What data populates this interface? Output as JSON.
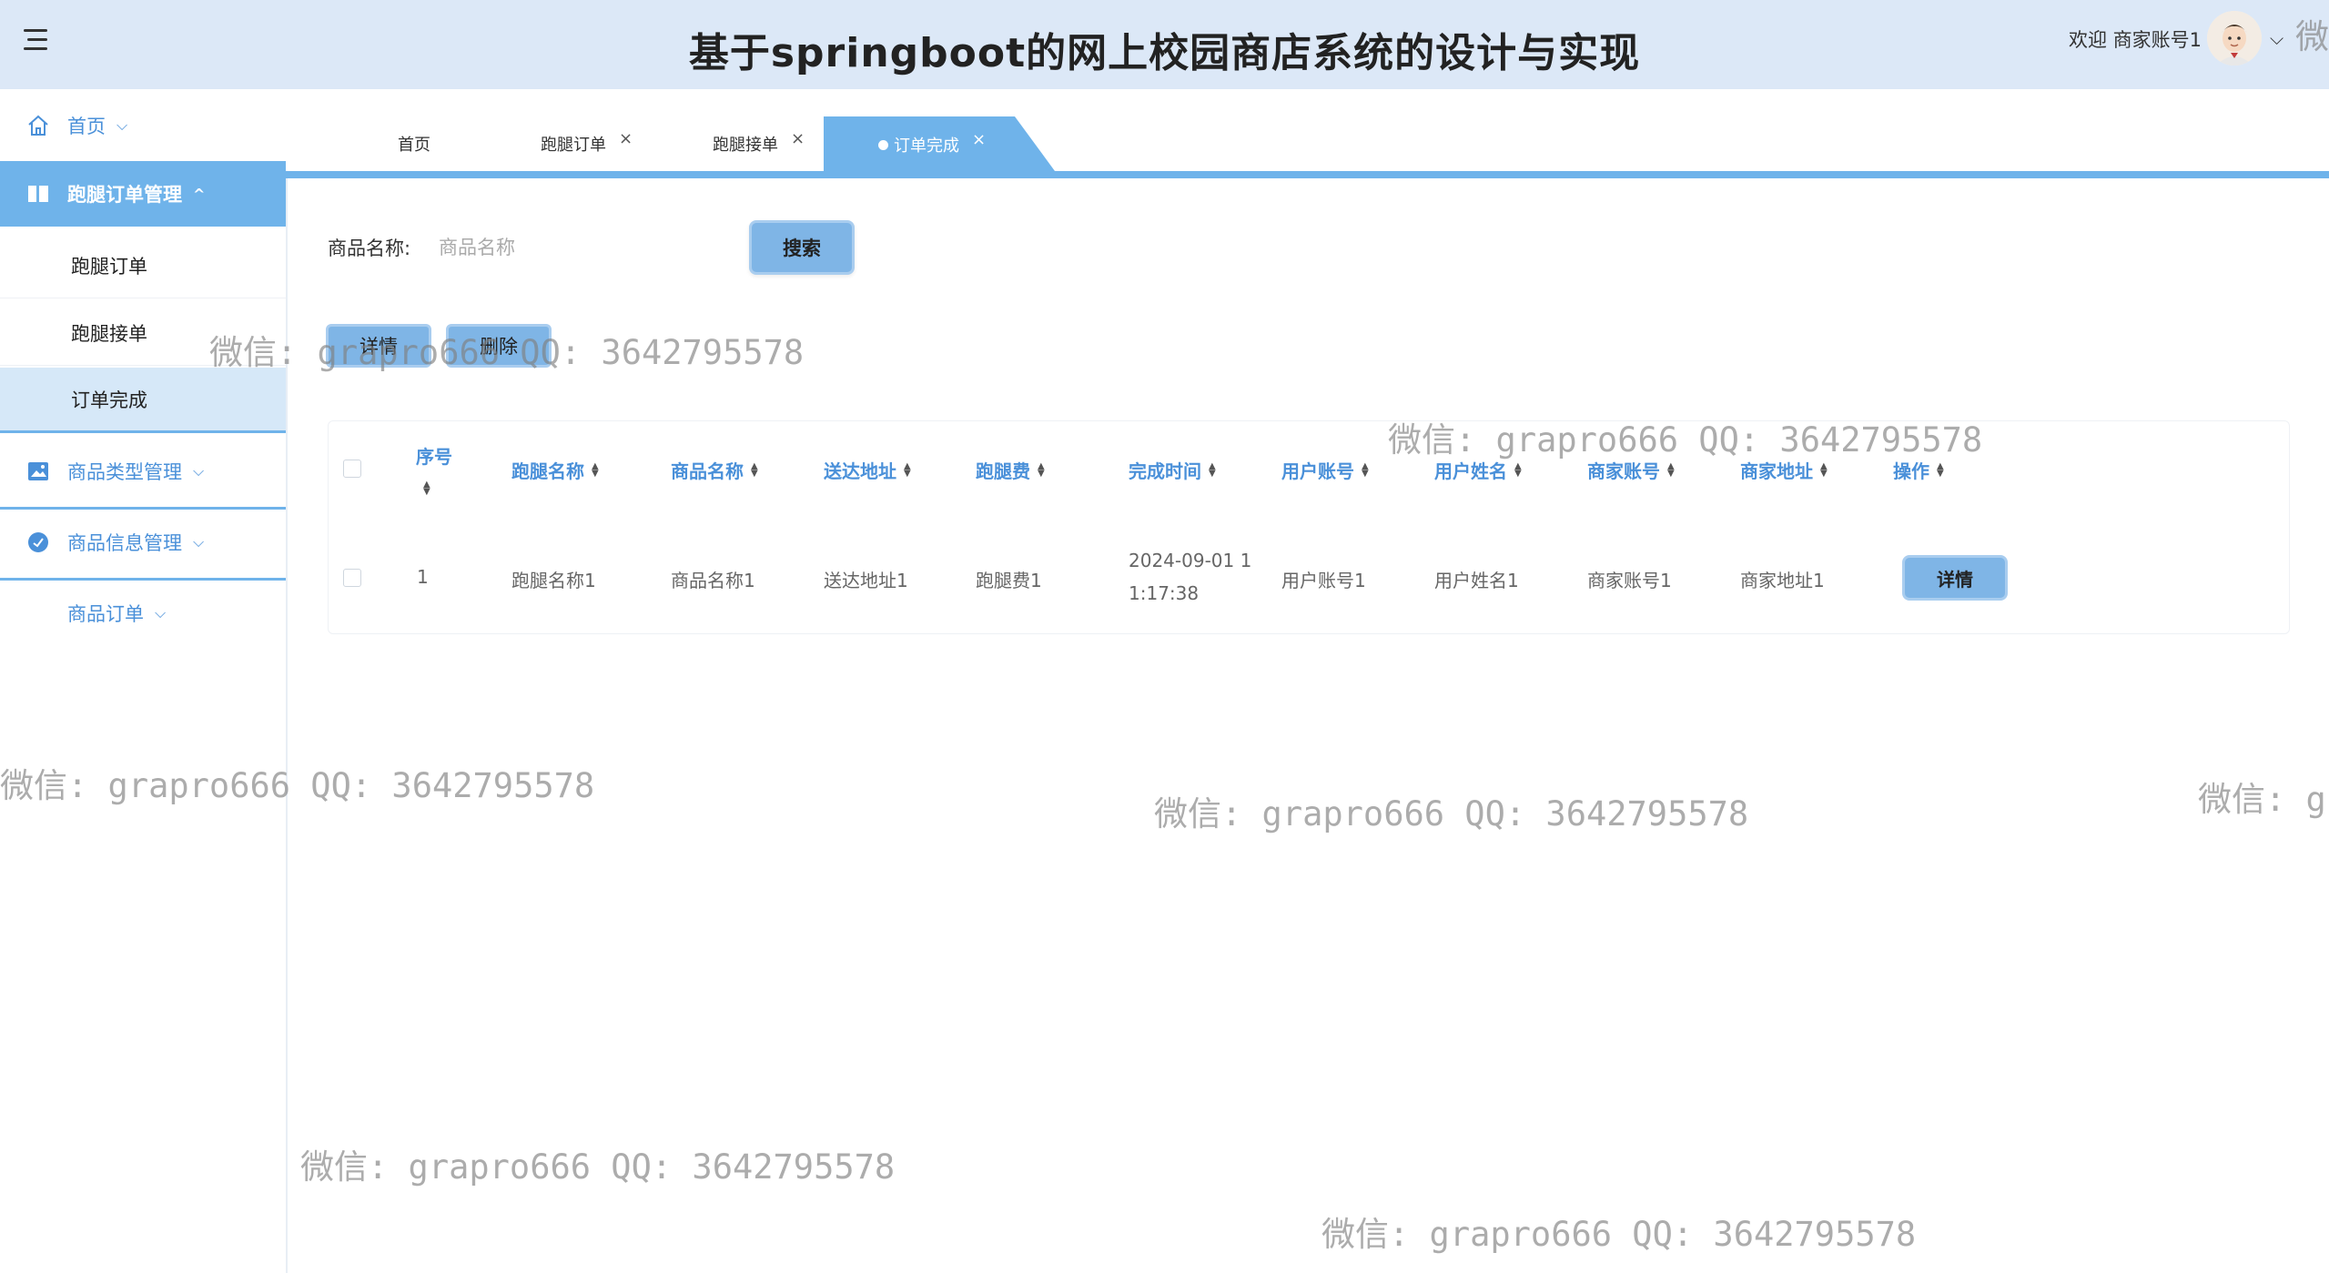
{
  "header": {
    "title": "基于springboot的网上校园商店系统的设计与实现",
    "welcome": "欢迎 商家账号1"
  },
  "sidebar": {
    "items": [
      {
        "label": "首页",
        "icon": "home-icon"
      },
      {
        "label": "跑腿订单管理",
        "icon": "grid-icon"
      },
      {
        "label": "商品类型管理",
        "icon": "image-icon"
      },
      {
        "label": "商品信息管理",
        "icon": "check-circle-icon"
      },
      {
        "label": "商品订单"
      }
    ],
    "subitems": [
      {
        "label": "跑腿订单"
      },
      {
        "label": "跑腿接单"
      },
      {
        "label": "订单完成"
      }
    ]
  },
  "tabs": [
    {
      "label": "首页"
    },
    {
      "label": "跑腿订单"
    },
    {
      "label": "跑腿接单"
    },
    {
      "label": "订单完成"
    }
  ],
  "search": {
    "label": "商品名称:",
    "placeholder": "商品名称",
    "button": "搜索"
  },
  "actions": {
    "detail": "详情",
    "delete": "删除"
  },
  "table": {
    "columns": [
      "序号",
      "跑腿名称",
      "商品名称",
      "送达地址",
      "跑腿费",
      "完成时间",
      "用户账号",
      "用户姓名",
      "商家账号",
      "商家地址",
      "操作"
    ],
    "rows": [
      {
        "index": "1",
        "run_name": "跑腿名称1",
        "product_name": "商品名称1",
        "address": "送达地址1",
        "fee": "跑腿费1",
        "time_line1": "2024-09-01 1",
        "time_line2": "1:17:38",
        "user_account": "用户账号1",
        "user_name": "用户姓名1",
        "merchant_account": "商家账号1",
        "merchant_address": "商家地址1",
        "action": "详情"
      }
    ]
  },
  "watermark": {
    "text": "微信: grapro666 QQ: 3642795578",
    "partial_a": "微",
    "partial_b": "微信: g"
  },
  "colors": {
    "header_bg": "#dce8f7",
    "accent": "#6fb3ea",
    "button": "#7fb5e6",
    "link_text": "#4a90d9"
  }
}
